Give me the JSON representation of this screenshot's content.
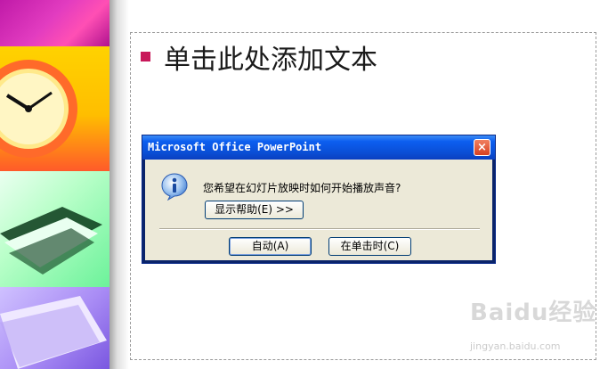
{
  "slide": {
    "title_placeholder": "单击此处添加文本",
    "bullet_color": "#c8185a"
  },
  "dialog": {
    "title": "Microsoft Office PowerPoint",
    "message": "您希望在幻灯片放映时如何开始播放声音?",
    "help_button": "显示帮助(E) >>",
    "auto_button": "自动(A)",
    "on_click_button": "在单击时(C)",
    "close_icon": "×",
    "icon": "info-icon"
  },
  "watermark": {
    "main": "Baidu经验",
    "sub": "jingyan.baidu.com"
  }
}
